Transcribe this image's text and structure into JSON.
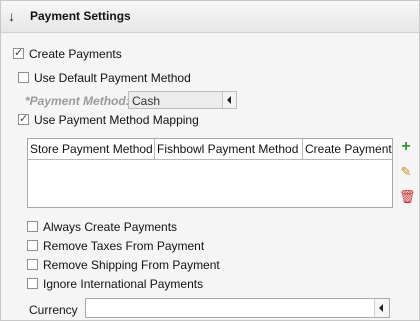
{
  "header": {
    "title": "Payment Settings",
    "collapse_icon": "arrow-down-icon"
  },
  "options": {
    "create_payments": {
      "label": "Create Payments",
      "checked": true
    },
    "use_default_method": {
      "label": "Use Default Payment Method",
      "checked": false
    },
    "payment_method_label": "*Payment Method:",
    "payment_method_value": "Cash",
    "use_mapping": {
      "label": "Use Payment Method Mapping",
      "checked": true
    }
  },
  "mapping_table": {
    "columns": [
      "Store Payment Method",
      "Fishbowl Payment Method",
      "Create Payment"
    ],
    "rows": []
  },
  "table_actions": {
    "add_icon": "plus-icon",
    "edit_icon": "pencil-icon",
    "delete_icon": "trash-icon"
  },
  "extra_options": [
    {
      "label": "Always Create Payments",
      "checked": false
    },
    {
      "label": "Remove Taxes From Payment",
      "checked": false
    },
    {
      "label": "Remove Shipping From Payment",
      "checked": false
    },
    {
      "label": "Ignore International Payments",
      "checked": false
    }
  ],
  "currency": {
    "label": "Currency",
    "value": ""
  },
  "colors": {
    "add": "#2a9a3a",
    "edit": "#d08a1e",
    "delete": "#c62828"
  }
}
